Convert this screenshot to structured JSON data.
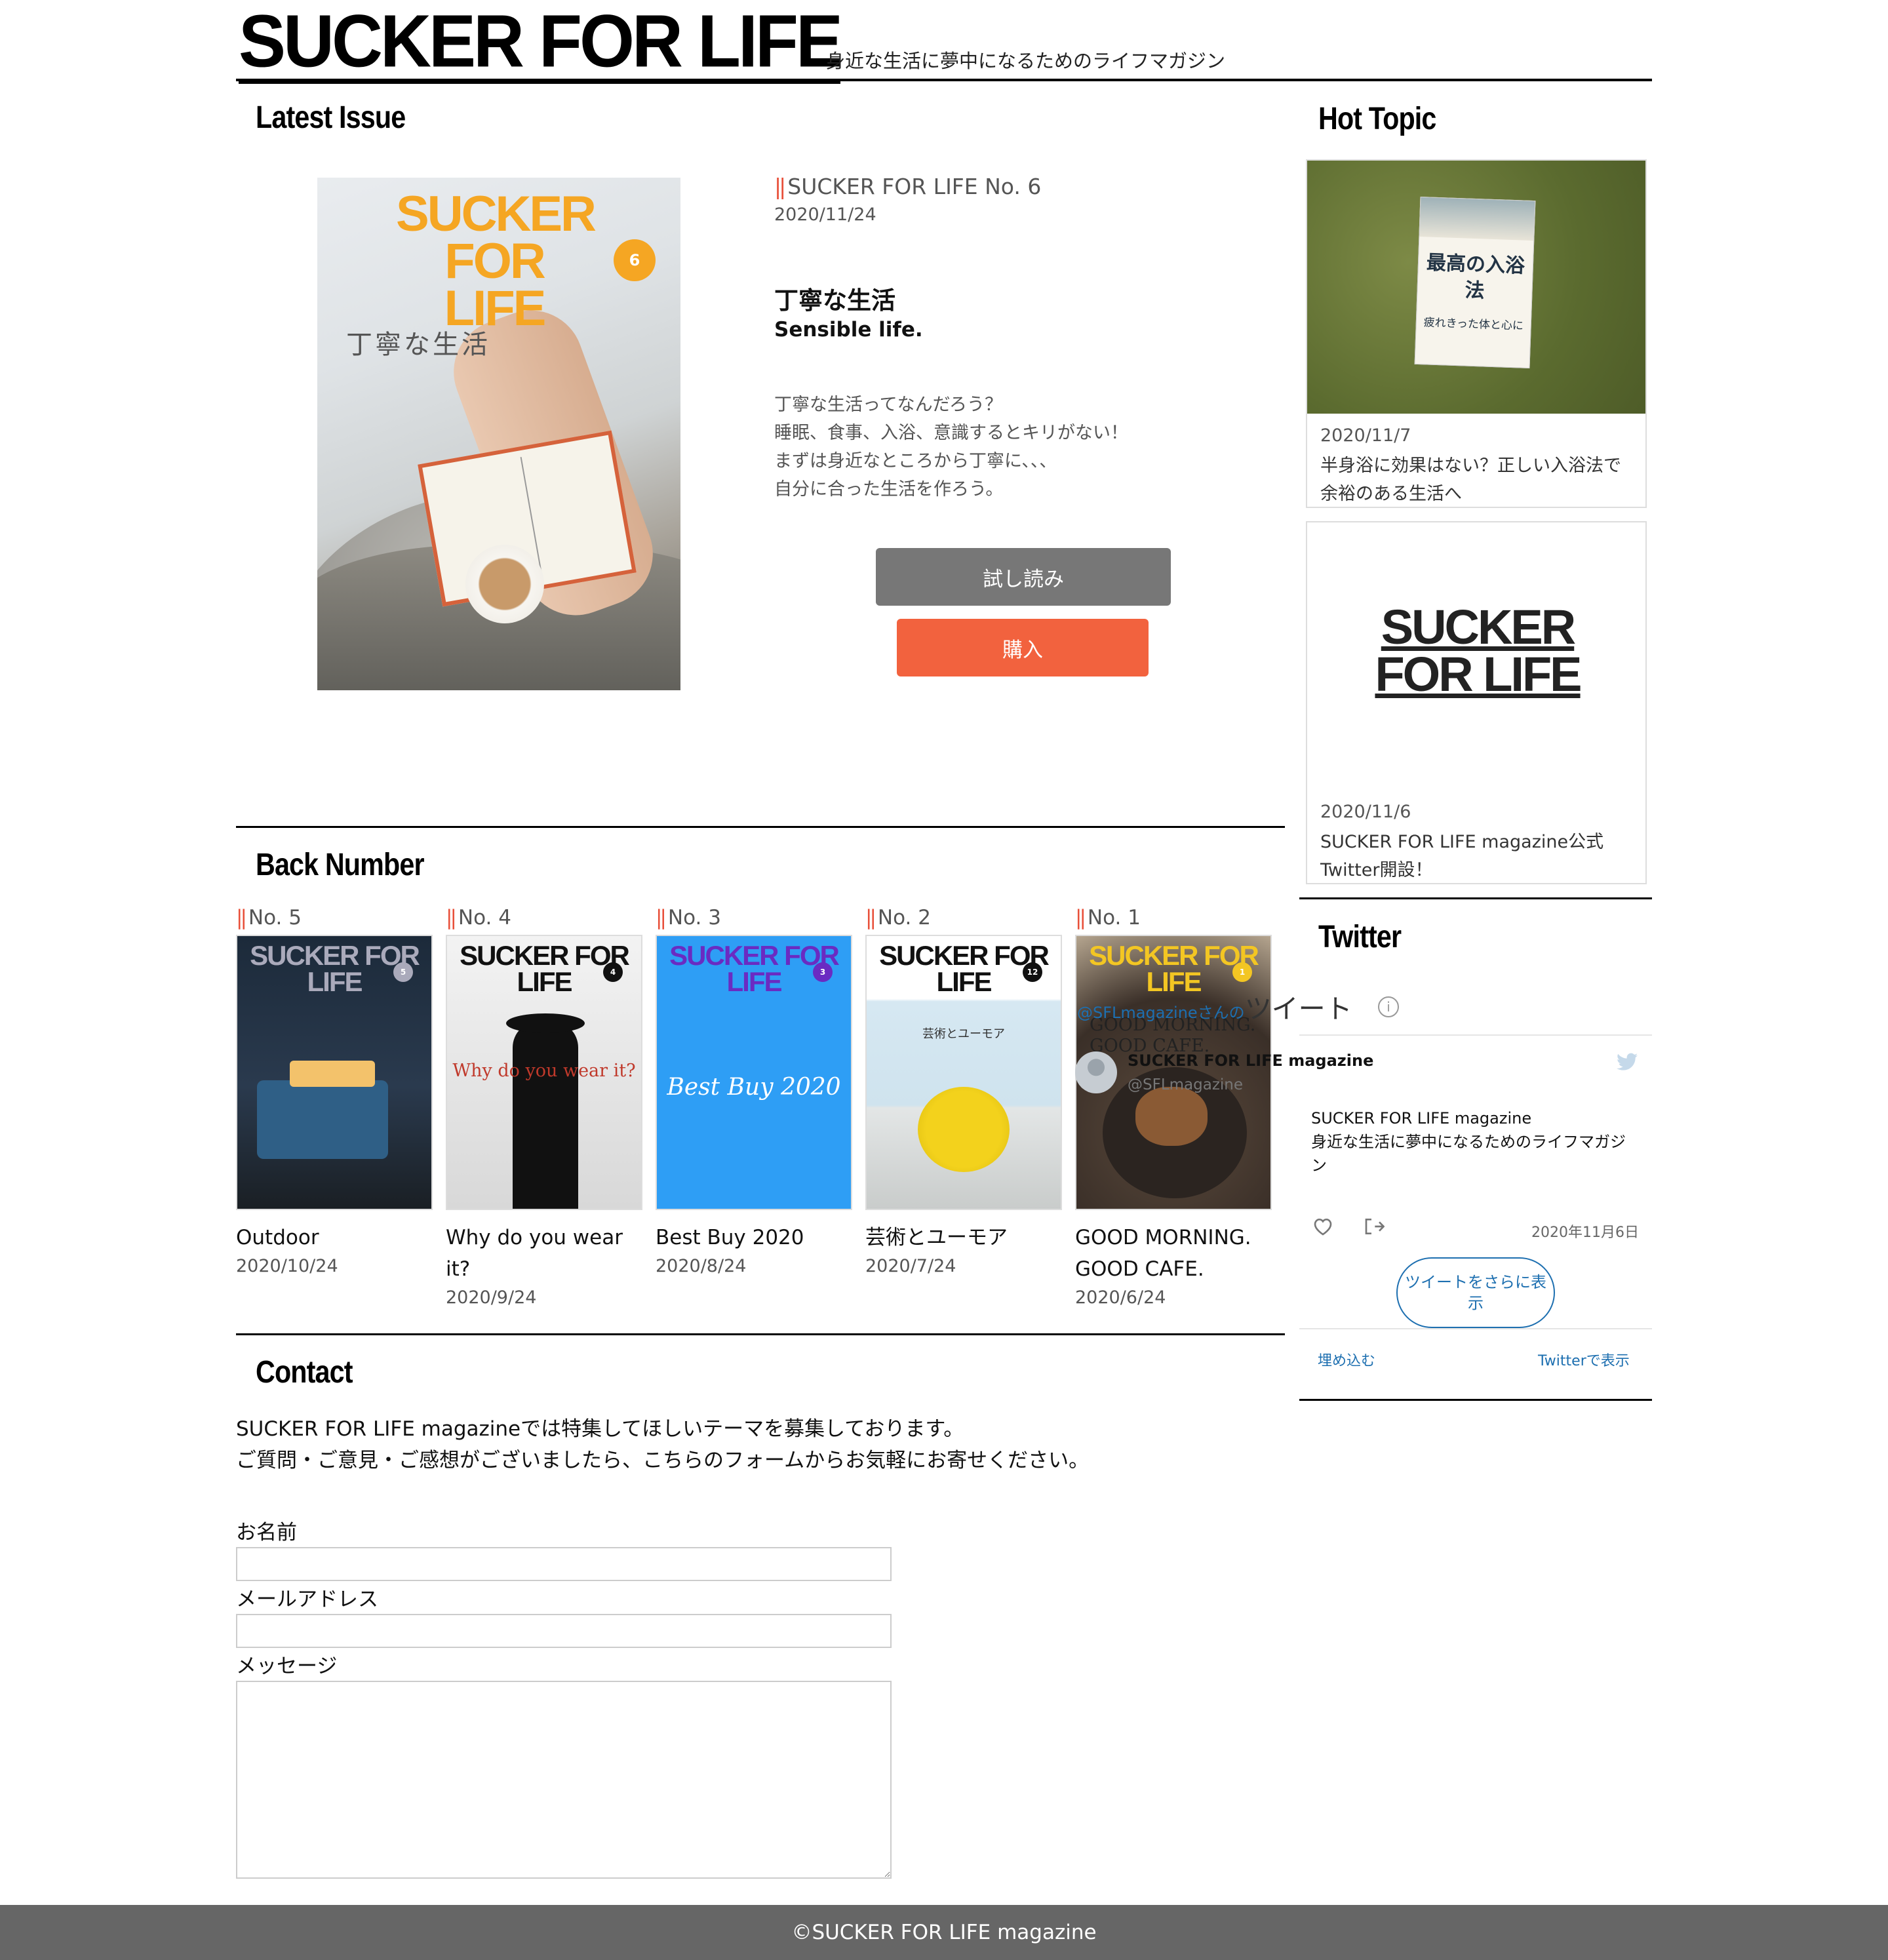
{
  "header": {
    "logo": "SUCKER FOR LIFE",
    "tagline": "身近な生活に夢中になるためのライフマガジン"
  },
  "latest": {
    "section_title": "Latest Issue",
    "cover_title": "SUCKER FOR LIFE",
    "cover_badge": "6",
    "cover_sub": "丁寧な生活",
    "issue_no": "SUCKER FOR LIFE No. 6",
    "date": "2020/11/24",
    "title_jp": "丁寧な生活",
    "title_en": "Sensible life.",
    "desc": [
      "丁寧な生活ってなんだろう？",
      "睡眠、食事、入浴、意識するとキリがない！",
      "まずは身近なところから丁寧に、、、",
      "自分に合った生活を作ろう。"
    ],
    "btn_read": "試し読み",
    "btn_buy": "購入",
    "accent": "#f5a623"
  },
  "back": {
    "section_title": "Back Number",
    "cover_logo": "SUCKER FOR LIFE",
    "items": [
      {
        "no": "No. 5",
        "badge": "5",
        "title": "Outdoor",
        "date": "2020/10/24",
        "sub": ""
      },
      {
        "no": "No. 4",
        "badge": "4",
        "title": "Why do you wear it?",
        "date": "2020/9/24",
        "sub": "Why do you wear it?"
      },
      {
        "no": "No. 3",
        "badge": "3",
        "title": "Best Buy 2020",
        "date": "2020/8/24",
        "sub": "Best Buy 2020"
      },
      {
        "no": "No. 2",
        "badge": "12",
        "title": "芸術とユーモア",
        "date": "2020/7/24",
        "sub": "芸術とユーモア"
      },
      {
        "no": "No. 1",
        "badge": "1",
        "title": "GOOD MORNING. GOOD CAFE.",
        "date": "2020/6/24",
        "sub": "GOOD MORNING. GOOD CAFE."
      }
    ]
  },
  "contact": {
    "section_title": "Contact",
    "text": [
      "SUCKER FOR LIFE magazineでは特集してほしいテーマを募集しております。",
      "ご質問・ご意見・ご感想がございましたら、こちらのフォームからお気軽にお寄せください。"
    ],
    "name_label": "お名前",
    "email_label": "メールアドレス",
    "message_label": "メッセージ",
    "name_value": "",
    "email_value": "",
    "message_value": ""
  },
  "hot": {
    "section_title": "Hot Topic",
    "cards": [
      {
        "date": "2020/11/7",
        "text": [
          "半身浴に効果はない？正しい入浴法で",
          "余裕のある生活へ"
        ],
        "book_title": "最高の入浴法",
        "book_sub": "疲れきった体と心に"
      },
      {
        "date": "2020/11/6",
        "text": [
          "SUCKER FOR LIFE magazine公式",
          "Twitter開設！"
        ],
        "logo": "SUCKER FOR LIFE"
      }
    ]
  },
  "twitter": {
    "section_title": "Twitter",
    "handle_link": "@SFLmagazine",
    "handle_suffix": "さんの",
    "tweets_label": "ツイート",
    "account_name": "SUCKER FOR LIFE magazine",
    "account_handle": "@SFLmagazine",
    "body": [
      "SUCKER FOR LIFE magazine",
      "身近な生活に夢中になるためのライフマガジ",
      "ン"
    ],
    "date": "2020年11月6日",
    "more": "ツイートをさらに表示",
    "embed": "埋め込む",
    "view": "Twitterで表示"
  },
  "footer": {
    "text": "©SUCKER FOR LIFE magazine"
  }
}
